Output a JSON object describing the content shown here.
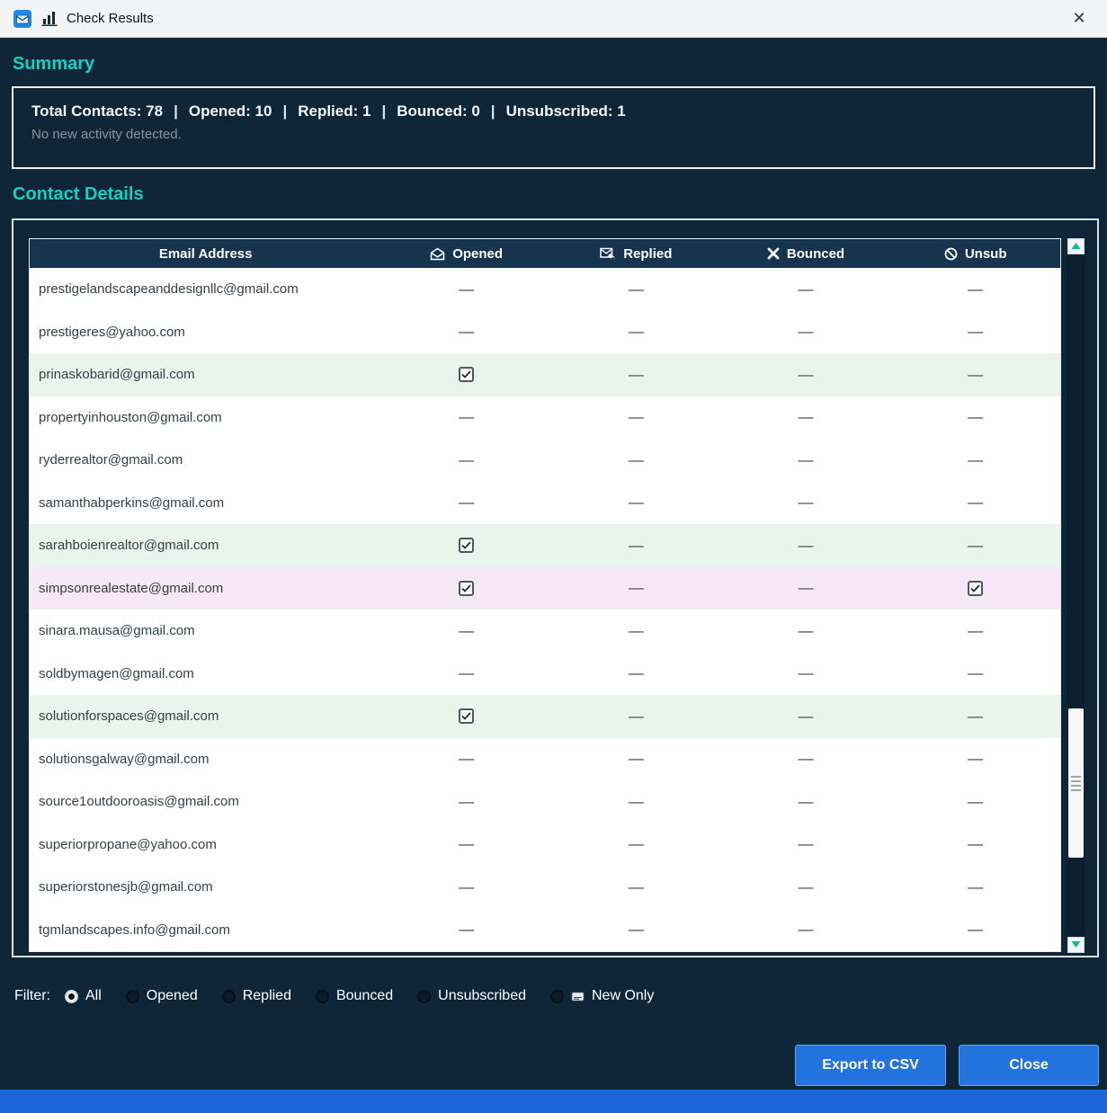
{
  "window": {
    "title": "Check Results",
    "close_glyph": "✕",
    "titlebar_icons": [
      "email-app-icon",
      "bar-chart-icon"
    ]
  },
  "summary": {
    "heading": "Summary",
    "separator": "|",
    "stats": [
      {
        "label": "Total Contacts:",
        "value": "78"
      },
      {
        "label": "Opened:",
        "value": "10"
      },
      {
        "label": "Replied:",
        "value": "1"
      },
      {
        "label": "Bounced:",
        "value": "0"
      },
      {
        "label": "Unsubscribed:",
        "value": "1"
      }
    ],
    "note": "No new activity detected."
  },
  "contact_details": {
    "heading": "Contact Details",
    "empty_cell": "—",
    "columns": [
      {
        "label": "Email Address",
        "icon": ""
      },
      {
        "label": "Opened",
        "icon": "opened"
      },
      {
        "label": "Replied",
        "icon": "replied"
      },
      {
        "label": "Bounced",
        "icon": "bounced"
      },
      {
        "label": "Unsub",
        "icon": "unsub"
      }
    ],
    "rows": [
      {
        "email": "prestigelandscapeanddesignllc@gmail.com",
        "opened": false,
        "replied": false,
        "bounced": false,
        "unsub": false,
        "highlight": "none"
      },
      {
        "email": "prestigeres@yahoo.com",
        "opened": false,
        "replied": false,
        "bounced": false,
        "unsub": false,
        "highlight": "none"
      },
      {
        "email": "prinaskobarid@gmail.com",
        "opened": true,
        "replied": false,
        "bounced": false,
        "unsub": false,
        "highlight": "opened"
      },
      {
        "email": "propertyinhouston@gmail.com",
        "opened": false,
        "replied": false,
        "bounced": false,
        "unsub": false,
        "highlight": "none"
      },
      {
        "email": "ryderrealtor@gmail.com",
        "opened": false,
        "replied": false,
        "bounced": false,
        "unsub": false,
        "highlight": "none"
      },
      {
        "email": "samanthabperkins@gmail.com",
        "opened": false,
        "replied": false,
        "bounced": false,
        "unsub": false,
        "highlight": "none"
      },
      {
        "email": "sarahboienrealtor@gmail.com",
        "opened": true,
        "replied": false,
        "bounced": false,
        "unsub": false,
        "highlight": "opened"
      },
      {
        "email": "simpsonrealestate@gmail.com",
        "opened": true,
        "replied": false,
        "bounced": false,
        "unsub": true,
        "highlight": "unsub"
      },
      {
        "email": "sinara.mausa@gmail.com",
        "opened": false,
        "replied": false,
        "bounced": false,
        "unsub": false,
        "highlight": "none"
      },
      {
        "email": "soldbymagen@gmail.com",
        "opened": false,
        "replied": false,
        "bounced": false,
        "unsub": false,
        "highlight": "none"
      },
      {
        "email": "solutionforspaces@gmail.com",
        "opened": true,
        "replied": false,
        "bounced": false,
        "unsub": false,
        "highlight": "opened"
      },
      {
        "email": "solutionsgalway@gmail.com",
        "opened": false,
        "replied": false,
        "bounced": false,
        "unsub": false,
        "highlight": "none"
      },
      {
        "email": "source1outdooroasis@gmail.com",
        "opened": false,
        "replied": false,
        "bounced": false,
        "unsub": false,
        "highlight": "none"
      },
      {
        "email": "superiorpropane@yahoo.com",
        "opened": false,
        "replied": false,
        "bounced": false,
        "unsub": false,
        "highlight": "none"
      },
      {
        "email": "superiorstonesjb@gmail.com",
        "opened": false,
        "replied": false,
        "bounced": false,
        "unsub": false,
        "highlight": "none"
      },
      {
        "email": "tgmlandscapes.info@gmail.com",
        "opened": false,
        "replied": false,
        "bounced": false,
        "unsub": false,
        "highlight": "none"
      }
    ]
  },
  "filter": {
    "label": "Filter:",
    "options": [
      {
        "label": "All",
        "selected": true
      },
      {
        "label": "Opened",
        "selected": false
      },
      {
        "label": "Replied",
        "selected": false
      },
      {
        "label": "Bounced",
        "selected": false
      },
      {
        "label": "Unsubscribed",
        "selected": false
      },
      {
        "label": "New Only",
        "selected": false,
        "icon": "new-badge"
      }
    ]
  },
  "actions": {
    "export_csv": "Export to CSV",
    "close": "Close"
  },
  "colors": {
    "background": "#0e2638",
    "accent_teal": "#15d0c5",
    "button_blue": "#2273dd",
    "row_opened": "#e9f5ec",
    "row_unsub": "#f6e8f6",
    "table_header_bg": "#17344f",
    "bottom_strip": "#1b66d9",
    "scroll_arrow": "#12b598"
  }
}
